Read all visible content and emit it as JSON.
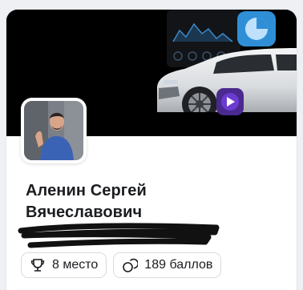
{
  "profile": {
    "name_line1": "Аленин Сергей",
    "name_line2": "Вячеславович"
  },
  "badges": {
    "place": {
      "icon": "trophy-icon",
      "label": "8 место"
    },
    "points": {
      "icon": "coins-icon",
      "label": "189 баллов"
    }
  },
  "colors": {
    "accent": "#2f8fd6",
    "play": "#6d3bd1",
    "card_bg": "#ffffff",
    "text": "#1b1d21"
  }
}
